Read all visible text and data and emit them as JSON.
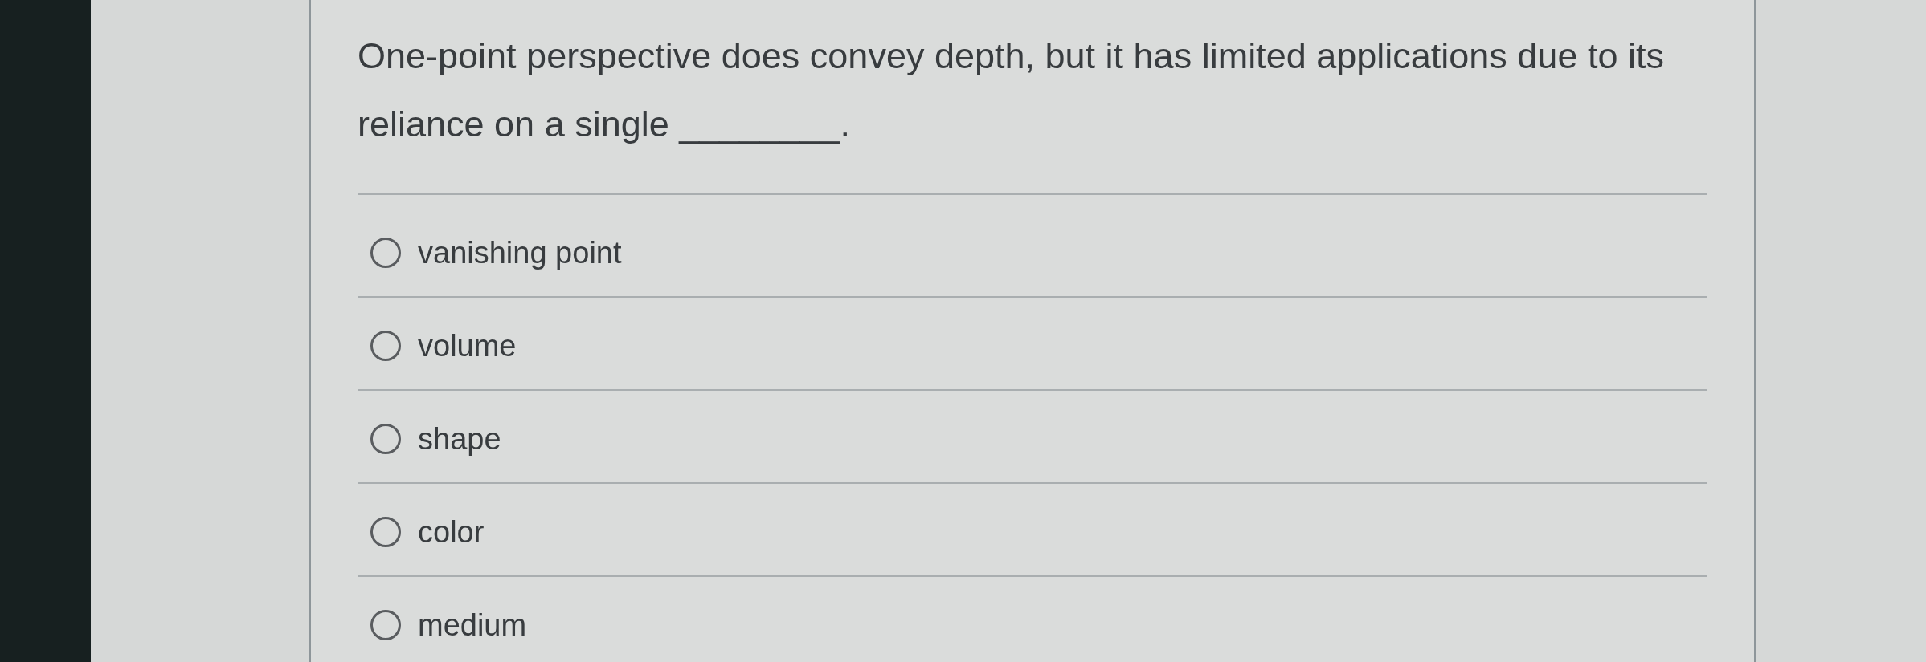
{
  "question": {
    "text": "One-point perspective does convey depth, but it has limited applications due to its reliance on a single ________."
  },
  "options": [
    {
      "label": "vanishing point",
      "selected": false
    },
    {
      "label": "volume",
      "selected": false
    },
    {
      "label": "shape",
      "selected": false
    },
    {
      "label": "color",
      "selected": false
    },
    {
      "label": "medium",
      "selected": false
    }
  ]
}
